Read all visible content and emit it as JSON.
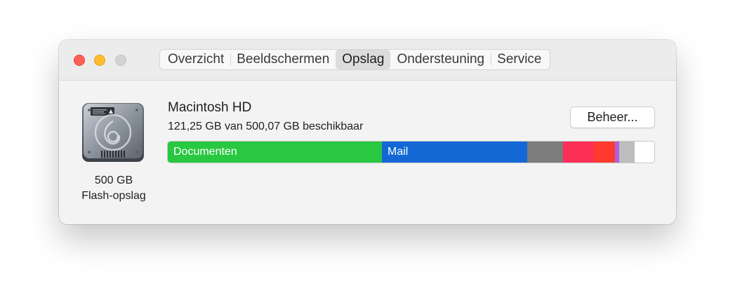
{
  "tabs": [
    {
      "label": "Overzicht",
      "selected": false
    },
    {
      "label": "Beeldschermen",
      "selected": false
    },
    {
      "label": "Opslag",
      "selected": true
    },
    {
      "label": "Ondersteuning",
      "selected": false
    },
    {
      "label": "Service",
      "selected": false
    }
  ],
  "disk": {
    "icon": "hard-drive-icon",
    "capacity": "500 GB",
    "type": "Flash-opslag"
  },
  "volume": {
    "name": "Macintosh HD",
    "free": "121,25 GB van 500,07 GB beschikbaar"
  },
  "manage_button": {
    "label": "Beheer..."
  },
  "storage_bar": {
    "segments": [
      {
        "category": "documents",
        "label": "Documenten",
        "fraction": 0.4396,
        "color": "#28c840"
      },
      {
        "category": "mail",
        "label": "Mail",
        "fraction": 0.2992,
        "color": "#1368d6"
      },
      {
        "category": "other-gray",
        "label": "",
        "fraction": 0.0735,
        "color": "#7c7c7c"
      },
      {
        "category": "pink",
        "label": "",
        "fraction": 0.0634,
        "color": "#fe2f56"
      },
      {
        "category": "red",
        "label": "",
        "fraction": 0.0432,
        "color": "#fe3a2f"
      },
      {
        "category": "purple",
        "label": "",
        "fraction": 0.0086,
        "color": "#b05ee0"
      },
      {
        "category": "system-gray",
        "label": "",
        "fraction": 0.0317,
        "color": "#bdbdbf"
      }
    ],
    "free_color": "#ffffff"
  },
  "colors": {
    "window_background": "#f3f3f3",
    "traffic_close": "#fe5f57",
    "traffic_minimize": "#febc2e",
    "traffic_zoom": "#d3d3d3"
  }
}
